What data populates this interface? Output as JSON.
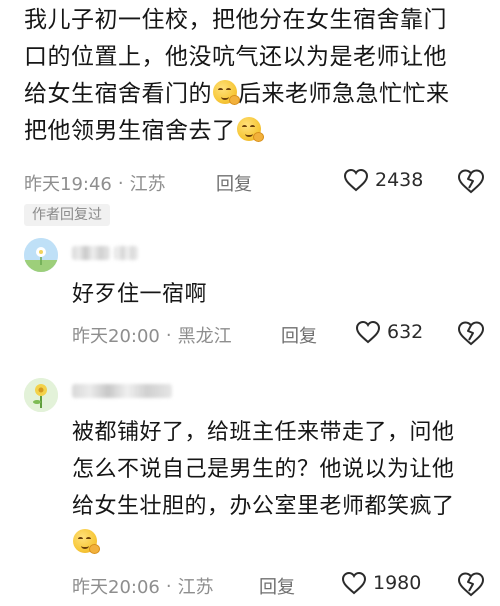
{
  "main_comment": {
    "lines": [
      "我儿子初一住校，把他分在女生宿舍靠门",
      "口的位置上，他没吭气还以为是老师让他",
      "给女生宿舍看门的",
      "后来老师急急忙忙来",
      "把他领男生宿舍去了"
    ],
    "time": "昨天19:46",
    "location": "江苏",
    "reply_label": "回复",
    "like_count": "2438",
    "emoji_name": "smirk-face-icon"
  },
  "author_replied_tag": "作者回复过",
  "replies": [
    {
      "text": "好歹住一宿啊",
      "time": "昨天20:00",
      "location": "黑龙江",
      "reply_label": "回复",
      "like_count": "632"
    },
    {
      "lines": [
        "被都铺好了，给班主任来带走了，问他",
        "怎么不说自己是男生的？他说以为让他",
        "给女生壮胆的，办公室里老师都笑疯了"
      ],
      "time": "昨天20:06",
      "location": "江苏",
      "reply_label": "回复",
      "like_count": "1980"
    }
  ],
  "colors": {
    "text": "#161616",
    "meta": "#8e8e8e",
    "tag_bg": "#f1f1f1"
  }
}
